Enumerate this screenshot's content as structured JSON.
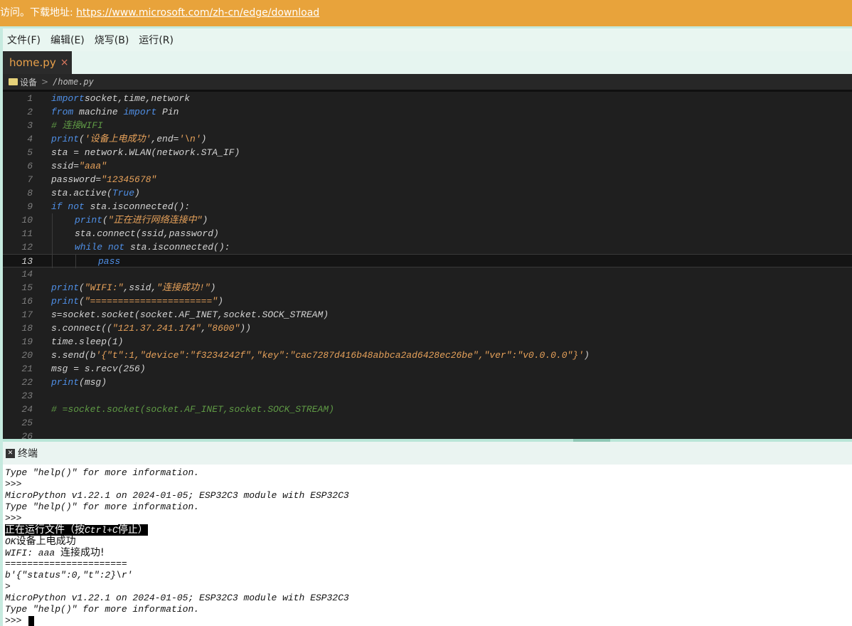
{
  "banner": {
    "prefix": "访问。下载地址:",
    "link": "https://www.microsoft.com/zh-cn/edge/download"
  },
  "menu": [
    "文件(F)",
    "编辑(E)",
    "烧写(B)",
    "运行(R)"
  ],
  "tab": {
    "label": "home.py",
    "close": "×"
  },
  "breadcrumb": {
    "device": "设备",
    "sep": ">",
    "path": "/home.py"
  },
  "editor": {
    "active_line": 13,
    "lines": [
      {
        "n": "1",
        "indent": 0,
        "tokens": [
          [
            "kw",
            "import"
          ],
          [
            "",
            "socket,time,network"
          ]
        ]
      },
      {
        "n": "2",
        "indent": 0,
        "tokens": [
          [
            "kw",
            "from"
          ],
          [
            "",
            " machine "
          ],
          [
            "kw",
            "import"
          ],
          [
            "",
            " Pin"
          ]
        ]
      },
      {
        "n": "3",
        "indent": 0,
        "tokens": [
          [
            "cm",
            "# 连接WIFI"
          ]
        ]
      },
      {
        "n": "4",
        "indent": 0,
        "tokens": [
          [
            "kw",
            "print"
          ],
          [
            "",
            "("
          ],
          [
            "str",
            "'设备上电成功'"
          ],
          [
            "",
            ",end="
          ],
          [
            "str",
            "'\\n'"
          ],
          [
            "",
            ")"
          ]
        ]
      },
      {
        "n": "5",
        "indent": 0,
        "tokens": [
          [
            "",
            "sta = network.WLAN(network.STA_IF)"
          ]
        ]
      },
      {
        "n": "6",
        "indent": 0,
        "tokens": [
          [
            "",
            "ssid="
          ],
          [
            "str",
            "\"aaa\""
          ]
        ]
      },
      {
        "n": "7",
        "indent": 0,
        "tokens": [
          [
            "",
            "password="
          ],
          [
            "str",
            "\"12345678\""
          ]
        ]
      },
      {
        "n": "8",
        "indent": 0,
        "tokens": [
          [
            "",
            "sta.active("
          ],
          [
            "cn",
            "True"
          ],
          [
            "",
            ")"
          ]
        ]
      },
      {
        "n": "9",
        "indent": 0,
        "tokens": [
          [
            "kw",
            "if"
          ],
          [
            "",
            " "
          ],
          [
            "kw",
            "not"
          ],
          [
            "",
            " sta.isconnected():"
          ]
        ]
      },
      {
        "n": "10",
        "indent": 1,
        "tokens": [
          [
            "kw",
            "print"
          ],
          [
            "",
            "("
          ],
          [
            "str",
            "\"正在进行网络连接中\""
          ],
          [
            "",
            ")"
          ]
        ]
      },
      {
        "n": "11",
        "indent": 1,
        "tokens": [
          [
            "",
            "sta.connect(ssid,password)"
          ]
        ]
      },
      {
        "n": "12",
        "indent": 1,
        "tokens": [
          [
            "kw",
            "while"
          ],
          [
            "",
            " "
          ],
          [
            "kw",
            "not"
          ],
          [
            "",
            " sta.isconnected():"
          ]
        ]
      },
      {
        "n": "13",
        "indent": 2,
        "tokens": [
          [
            "kw",
            "pass"
          ]
        ]
      },
      {
        "n": "14",
        "indent": 0,
        "tokens": []
      },
      {
        "n": "15",
        "indent": 0,
        "tokens": [
          [
            "kw",
            "print"
          ],
          [
            "",
            "("
          ],
          [
            "str",
            "\"WIFI:\""
          ],
          [
            "",
            ",ssid,"
          ],
          [
            "str",
            "\"连接成功!\""
          ],
          [
            "",
            ")"
          ]
        ]
      },
      {
        "n": "16",
        "indent": 0,
        "tokens": [
          [
            "kw",
            "print"
          ],
          [
            "",
            "("
          ],
          [
            "str",
            "\"======================\""
          ],
          [
            "",
            ")"
          ]
        ]
      },
      {
        "n": "17",
        "indent": 0,
        "tokens": [
          [
            "",
            "s=socket.socket(socket.AF_INET,socket.SOCK_STREAM)"
          ]
        ]
      },
      {
        "n": "18",
        "indent": 0,
        "tokens": [
          [
            "",
            "s.connect(("
          ],
          [
            "str",
            "\"121.37.241.174\""
          ],
          [
            "",
            ","
          ],
          [
            "str",
            "\"8600\""
          ],
          [
            "",
            "))"
          ]
        ]
      },
      {
        "n": "19",
        "indent": 0,
        "tokens": [
          [
            "",
            "time.sleep(1)"
          ]
        ]
      },
      {
        "n": "20",
        "indent": 0,
        "tokens": [
          [
            "",
            "s.send(b"
          ],
          [
            "str",
            "'{\"t\":1,\"device\":\"f3234242f\",\"key\":\"cac7287d416b48abbca2ad6428ec26be\",\"ver\":\"v0.0.0.0\"}'"
          ],
          [
            "",
            ")"
          ]
        ]
      },
      {
        "n": "21",
        "indent": 0,
        "tokens": [
          [
            "",
            "msg = s.recv(256)"
          ]
        ]
      },
      {
        "n": "22",
        "indent": 0,
        "tokens": [
          [
            "kw",
            "print"
          ],
          [
            "",
            "(msg)"
          ]
        ]
      },
      {
        "n": "23",
        "indent": 0,
        "tokens": []
      },
      {
        "n": "24",
        "indent": 0,
        "tokens": [
          [
            "cm",
            "# =socket.socket(socket.AF_INET,socket.SOCK_STREAM)"
          ]
        ]
      },
      {
        "n": "25",
        "indent": 0,
        "tokens": []
      },
      {
        "n": "26",
        "indent": 0,
        "tokens": []
      }
    ]
  },
  "terminal": {
    "title": "终端",
    "icon_glyph": "✕",
    "lines": [
      [
        [
          "",
          "Type \"help()\" for more information."
        ]
      ],
      [
        [
          "",
          ">>>"
        ]
      ],
      [
        [
          "",
          "MicroPython v1.22.1 on 2024-01-05; ESP32C3 module with ESP32C3"
        ]
      ],
      [
        [
          "",
          "Type \"help()\" for more information."
        ]
      ],
      [
        [
          "",
          ">>>"
        ]
      ],
      [
        [
          "hl-cjk",
          "正在运行文件（按"
        ],
        [
          "hl",
          "Ctrl+C"
        ],
        [
          "hl-cjk",
          "停止）"
        ]
      ],
      [
        [
          "",
          "OK"
        ],
        [
          "cjk",
          "设备上电成功"
        ]
      ],
      [
        [
          "",
          "WIFI: aaa "
        ],
        [
          "cjk",
          "连接成功!"
        ]
      ],
      [
        [
          "",
          "======================"
        ]
      ],
      [
        [
          "",
          "b'{\"status\":0,\"t\":2}\\r'"
        ]
      ],
      [
        [
          "",
          ">"
        ]
      ],
      [
        [
          "",
          "MicroPython v1.22.1 on 2024-01-05; ESP32C3 module with ESP32C3"
        ]
      ],
      [
        [
          "",
          "Type \"help()\" for more information."
        ]
      ],
      [
        [
          "",
          ">>> "
        ]
      ]
    ]
  }
}
